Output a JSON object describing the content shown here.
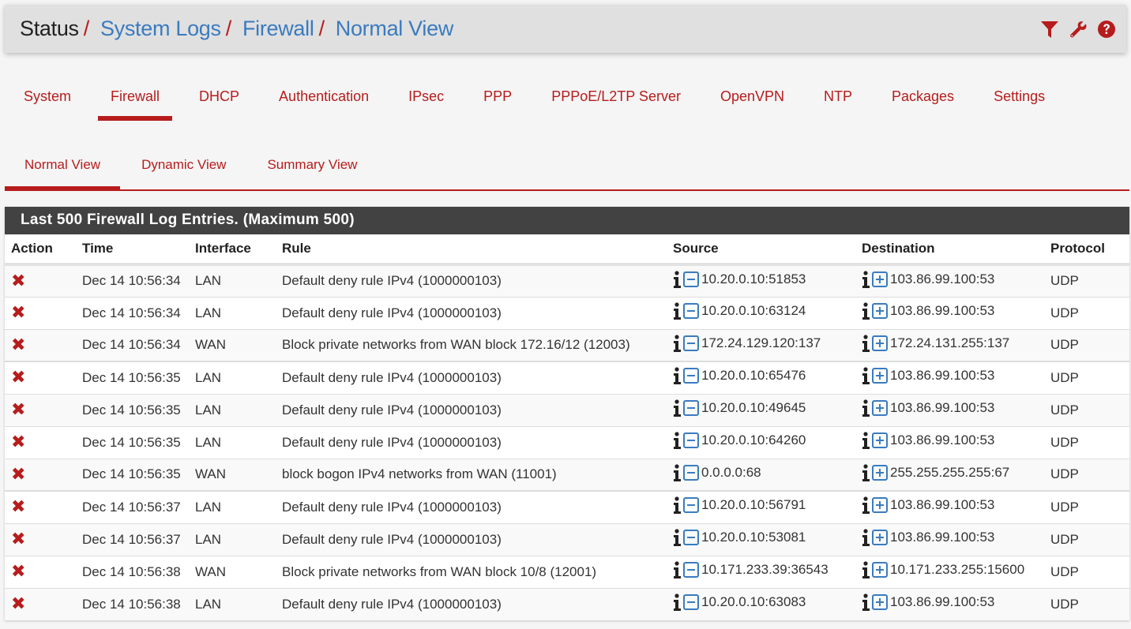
{
  "header": {
    "breadcrumb": [
      {
        "label": "Status",
        "link": false
      },
      {
        "label": "System Logs",
        "link": true
      },
      {
        "label": "Firewall",
        "link": true
      },
      {
        "label": "Normal View",
        "link": true
      }
    ],
    "separator": "/",
    "icons": [
      "filter-icon",
      "wrench-icon",
      "help-icon"
    ]
  },
  "main_tabs": [
    {
      "label": "System",
      "active": false
    },
    {
      "label": "Firewall",
      "active": true
    },
    {
      "label": "DHCP",
      "active": false
    },
    {
      "label": "Authentication",
      "active": false
    },
    {
      "label": "IPsec",
      "active": false
    },
    {
      "label": "PPP",
      "active": false
    },
    {
      "label": "PPPoE/L2TP Server",
      "active": false
    },
    {
      "label": "OpenVPN",
      "active": false
    },
    {
      "label": "NTP",
      "active": false
    },
    {
      "label": "Packages",
      "active": false
    },
    {
      "label": "Settings",
      "active": false
    }
  ],
  "sub_tabs": [
    {
      "label": "Normal View",
      "active": true
    },
    {
      "label": "Dynamic View",
      "active": false
    },
    {
      "label": "Summary View",
      "active": false
    }
  ],
  "panel": {
    "title": "Last 500 Firewall Log Entries. (Maximum 500)",
    "columns": [
      "Action",
      "Time",
      "Interface",
      "Rule",
      "Source",
      "Destination",
      "Protocol"
    ],
    "rows": [
      {
        "action": "block",
        "time": "Dec 14 10:56:34",
        "interface": "LAN",
        "rule": "Default deny rule IPv4 (1000000103)",
        "source": "10.20.0.10:51853",
        "destination": "103.86.99.100:53",
        "protocol": "UDP"
      },
      {
        "action": "block",
        "time": "Dec 14 10:56:34",
        "interface": "LAN",
        "rule": "Default deny rule IPv4 (1000000103)",
        "source": "10.20.0.10:63124",
        "destination": "103.86.99.100:53",
        "protocol": "UDP"
      },
      {
        "action": "block",
        "time": "Dec 14 10:56:34",
        "interface": "WAN",
        "rule": "Block private networks from WAN block 172.16/12 (12003)",
        "source": "172.24.129.120:137",
        "destination": "172.24.131.255:137",
        "protocol": "UDP"
      },
      {
        "action": "block",
        "time": "Dec 14 10:56:35",
        "interface": "LAN",
        "rule": "Default deny rule IPv4 (1000000103)",
        "source": "10.20.0.10:65476",
        "destination": "103.86.99.100:53",
        "protocol": "UDP"
      },
      {
        "action": "block",
        "time": "Dec 14 10:56:35",
        "interface": "LAN",
        "rule": "Default deny rule IPv4 (1000000103)",
        "source": "10.20.0.10:49645",
        "destination": "103.86.99.100:53",
        "protocol": "UDP"
      },
      {
        "action": "block",
        "time": "Dec 14 10:56:35",
        "interface": "LAN",
        "rule": "Default deny rule IPv4 (1000000103)",
        "source": "10.20.0.10:64260",
        "destination": "103.86.99.100:53",
        "protocol": "UDP"
      },
      {
        "action": "block",
        "time": "Dec 14 10:56:35",
        "interface": "WAN",
        "rule": "block bogon IPv4 networks from WAN (11001)",
        "source": "0.0.0.0:68",
        "destination": "255.255.255.255:67",
        "protocol": "UDP"
      },
      {
        "action": "block",
        "time": "Dec 14 10:56:37",
        "interface": "LAN",
        "rule": "Default deny rule IPv4 (1000000103)",
        "source": "10.20.0.10:56791",
        "destination": "103.86.99.100:53",
        "protocol": "UDP"
      },
      {
        "action": "block",
        "time": "Dec 14 10:56:37",
        "interface": "LAN",
        "rule": "Default deny rule IPv4 (1000000103)",
        "source": "10.20.0.10:53081",
        "destination": "103.86.99.100:53",
        "protocol": "UDP"
      },
      {
        "action": "block",
        "time": "Dec 14 10:56:38",
        "interface": "WAN",
        "rule": "Block private networks from WAN block 10/8 (12001)",
        "source": "10.171.233.39:36543",
        "destination": "10.171.233.255:15600",
        "protocol": "UDP"
      },
      {
        "action": "block",
        "time": "Dec 14 10:56:38",
        "interface": "LAN",
        "rule": "Default deny rule IPv4 (1000000103)",
        "source": "10.20.0.10:63083",
        "destination": "103.86.99.100:53",
        "protocol": "UDP"
      }
    ]
  },
  "colors": {
    "accent": "#b71c1c",
    "link": "#3a7bbf",
    "panel_heading": "#424242",
    "header_bg": "#e0e0e0"
  }
}
